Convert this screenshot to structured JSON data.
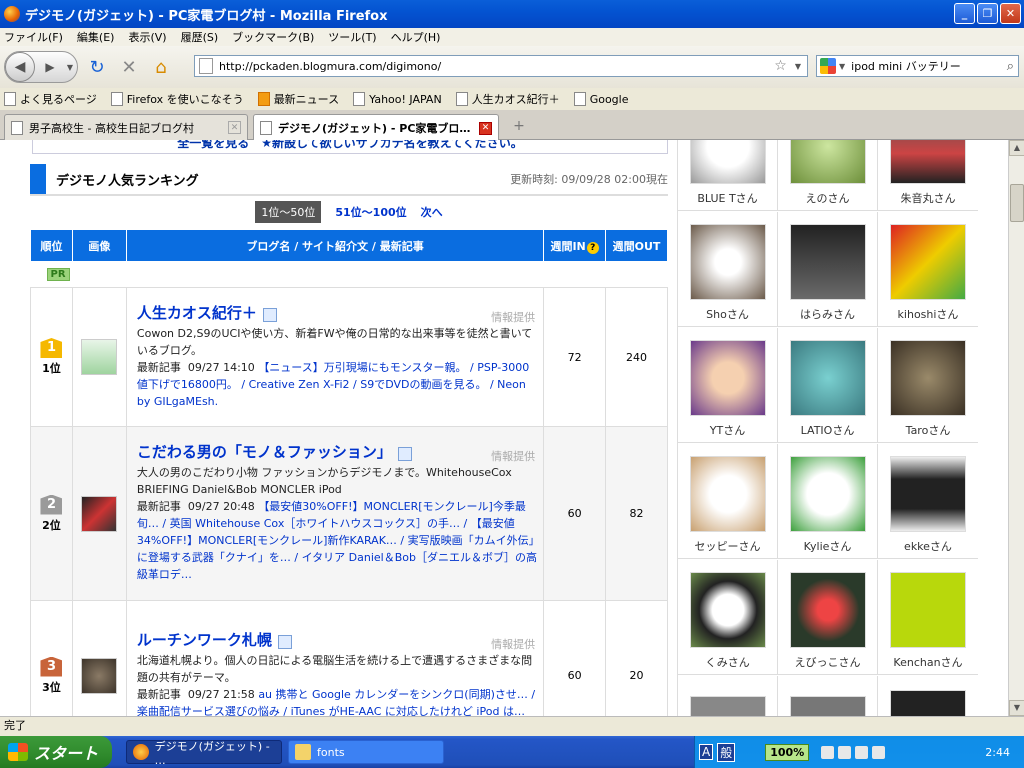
{
  "window": {
    "title": "デジモノ(ガジェット) - PC家電ブログ村 - Mozilla Firefox"
  },
  "menu": [
    "ファイル(F)",
    "編集(E)",
    "表示(V)",
    "履歴(S)",
    "ブックマーク(B)",
    "ツール(T)",
    "ヘルプ(H)"
  ],
  "nav": {
    "url": "http://pckaden.blogmura.com/digimono/",
    "search": "ipod mini バッテリー"
  },
  "bookmarks": [
    "よく見るページ",
    "Firefox を使いこなそう",
    "最新ニュース",
    "Yahoo! JAPAN",
    "人生カオス紀行＋",
    "Google"
  ],
  "tabs": [
    {
      "label": "男子高校生 - 高校生日記ブログ村"
    },
    {
      "label": "デジモノ(ガジェット) - PC家電ブロ…"
    }
  ],
  "page": {
    "top_links": "全一覧を見る　★新設して欲しいサブカテ名を教えてください。",
    "ranking_title": "デジモノ人気ランキング",
    "updated": "更新時刻: 09/09/28 02:00現在",
    "pager": {
      "current": "1位〜50位",
      "next_range": "51位〜100位",
      "next": "次へ"
    },
    "columns": [
      "順位",
      "画像",
      "ブログ名 / サイト紹介文 / 最新記事",
      "週間IN",
      "週間OUT"
    ],
    "pr": "PR",
    "info_label": "情報提供",
    "latest_label": "最新記事",
    "rows": [
      {
        "rank": "1位",
        "medal": "1",
        "title": "人生カオス紀行＋",
        "desc": "Cowon D2,S9のUCIや使い方、新着FWや俺の日常的な出来事等を徒然と書いているブログ。",
        "latest_time": "09/27 14:10",
        "latest_links": "【ニュース】万引現場にもモンスター親。 / PSP-3000値下げで16800円。 / Creative Zen X-Fi2 / S9でDVDの動画を見る。 / Neon by GILgaMEsh.",
        "in": "72",
        "out": "240"
      },
      {
        "rank": "2位",
        "medal": "2",
        "title": "こだわる男の「モノ＆ファッション」",
        "desc": "大人の男のこだわり小物 ファッションからデジモノまで。WhitehouseCox BRIEFING Daniel&Bob MONCLER iPod",
        "latest_time": "09/27 20:48",
        "latest_links": "【最安値30%OFF!】MONCLER[モンクレール]今季最旬… / 英国 Whitehouse Cox［ホワイトハウスコックス］の手… / 【最安値34%OFF!】MONCLER[モンクレール]新作KARAK… / 実写版映画「カムイ外伝」に登場する武器「クナイ」を… / イタリア Daniel＆Bob［ダニエル＆ボブ］の高級革ロデ…",
        "in": "60",
        "out": "82"
      },
      {
        "rank": "3位",
        "medal": "3",
        "title": "ルーチンワーク札幌",
        "desc": "北海道札幌より。個人の日記による電脳生活を続ける上で遭遇するさまざまな問題の共有がテーマ。",
        "latest_time": "09/27 21:58",
        "latest_links": "au 携帯と Google カレンダーをシンクロ(同期)させ… / 楽曲配信サービス選びの悩み / iTunes がHE-AAC に対応したけれど iPod は…",
        "in": "60",
        "out": "20"
      }
    ],
    "users": [
      "BLUE Tさん",
      "えのさん",
      "朱音丸さん",
      "Shoさん",
      "はらみさん",
      "kihoshiさん",
      "YTさん",
      "LATIOさん",
      "Taroさん",
      "セッピーさん",
      "Kylieさん",
      "ekkeさん",
      "くみさん",
      "えびっこさん",
      "Kenchanさん"
    ]
  },
  "status": "完了",
  "taskbar": {
    "start": "スタート",
    "tasks": [
      "デジモノ(ガジェット) - …",
      "fonts"
    ],
    "ime": [
      "A",
      "般"
    ],
    "battery": "100%",
    "clock": "2:44"
  }
}
